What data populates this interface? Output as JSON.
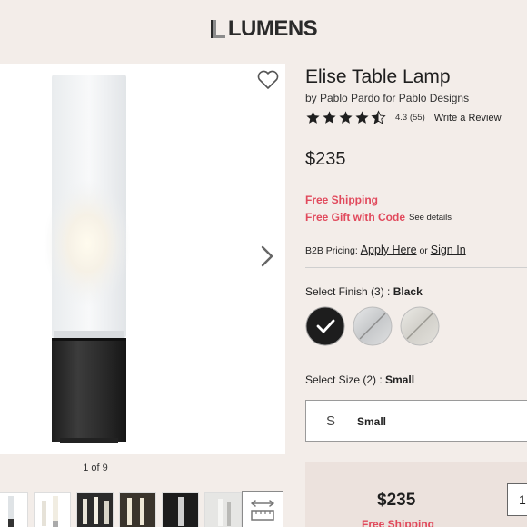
{
  "brand": {
    "name": "LUMENS"
  },
  "product": {
    "title": "Elise Table Lamp",
    "byline": "by Pablo Pardo for Pablo Designs",
    "rating": {
      "stars": 4.3,
      "text": "4.3 (55)",
      "review_link": "Write a Review"
    },
    "price": "$235",
    "promos": {
      "shipping": "Free Shipping",
      "gift": "Free Gift with Code",
      "details": "See details"
    },
    "b2b": {
      "label": "B2B Pricing:",
      "apply": "Apply Here",
      "or": "or",
      "signin": "Sign In"
    },
    "finish": {
      "label": "Select Finish (3) :",
      "selected": "Black",
      "swatches": [
        "black",
        "aluminum",
        "brushed-nickel"
      ]
    },
    "size": {
      "label": "Select Size (2) :",
      "selected": "Small",
      "code": "S",
      "name": "Small"
    }
  },
  "gallery": {
    "counter": "1 of 9"
  },
  "buy_box": {
    "price": "$235",
    "shipping": "Free Shipping",
    "quantity": "1"
  },
  "colors": {
    "accent": "#e1495c",
    "background": "#f3ede9"
  }
}
